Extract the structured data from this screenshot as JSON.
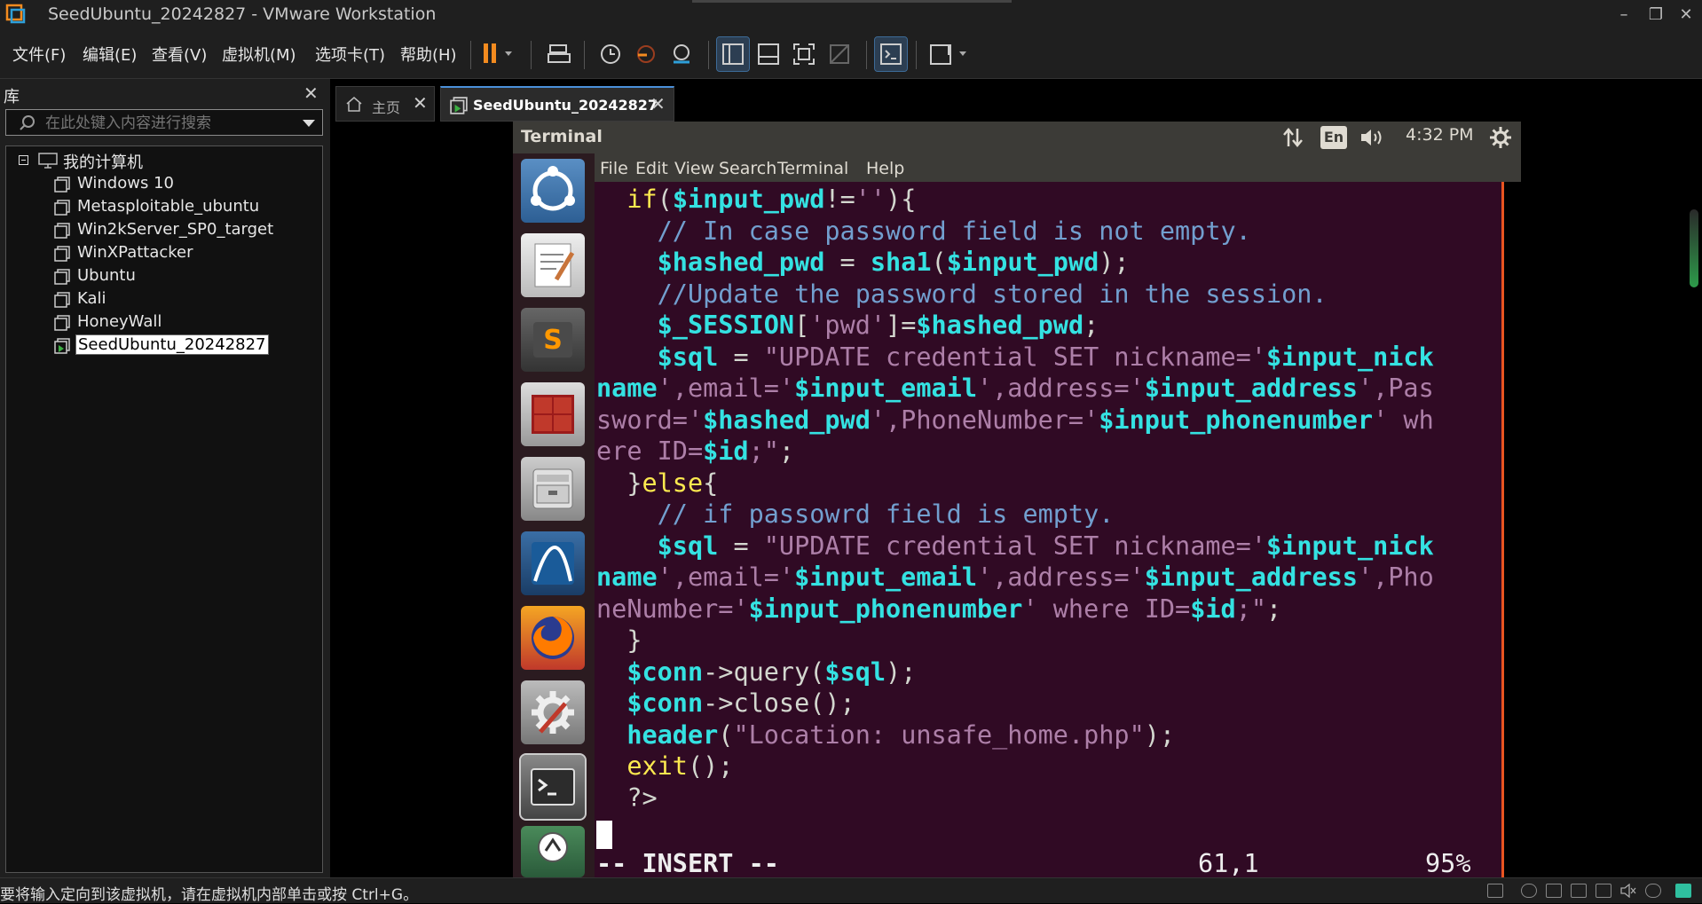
{
  "window": {
    "title": "SeedUbuntu_20242827 - VMware Workstation",
    "minimize": "–",
    "restore": "❐",
    "close": "✕"
  },
  "menu": {
    "file": "文件(F)",
    "edit": "编辑(E)",
    "view": "查看(V)",
    "vm": "虚拟机(M)",
    "tabs": "选项卡(T)",
    "help": "帮助(H)"
  },
  "library": {
    "title": "库",
    "close": "✕",
    "search_placeholder": "在此处键入内容进行搜索",
    "root": "我的计算机",
    "vms": [
      "Windows 10",
      "Metasploitable_ubuntu",
      "Win2kServer_SP0_target",
      "WinXPattacker",
      "Ubuntu",
      "Kali",
      "HoneyWall",
      "SeedUbuntu_20242827"
    ]
  },
  "tabs": {
    "home": "主页",
    "vm": "SeedUbuntu_20242827",
    "close": "✕"
  },
  "guest": {
    "topbar_title": "Terminal",
    "lang": "En",
    "time": "4:32 PM",
    "terminal_menu": [
      "File",
      "Edit",
      "View",
      "Search",
      "Terminal",
      "Help"
    ],
    "vim_mode": "-- INSERT --",
    "cursor_pos": "61,1",
    "scroll_pct": "95%"
  },
  "statusbar": {
    "message": "要将输入定向到该虚拟机，请在虚拟机内部单击或按 Ctrl+G。"
  },
  "colors": {
    "terminal_bg": "#300a24",
    "ubuntu_orange": "#e95420",
    "vmware_dark": "#1f1f1f",
    "tab_accent": "#4a90d9"
  }
}
